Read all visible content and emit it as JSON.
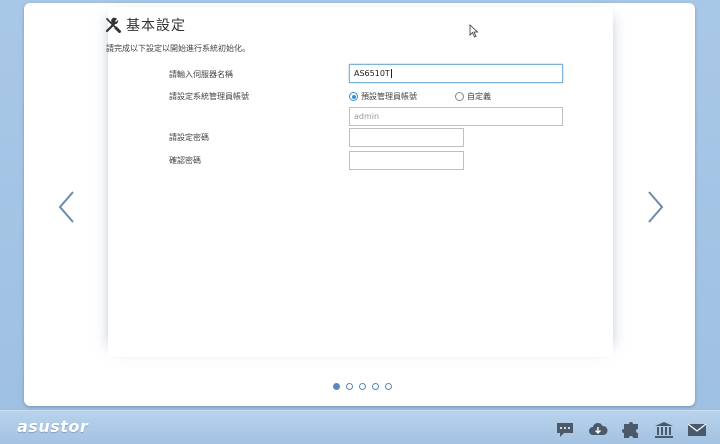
{
  "page": {
    "title": "基本設定",
    "intro": "請完成以下設定以開始進行系統初始化。"
  },
  "form": {
    "server_name_label": "請輸入伺服器名稱",
    "server_name_value": "AS6510T",
    "admin_account_label": "請設定系統管理員帳號",
    "radio_default_label": "預設管理員帳號",
    "radio_custom_label": "自定義",
    "admin_placeholder": "admin",
    "password_label": "請設定密碼",
    "confirm_password_label": "確認密碼"
  },
  "pagination": {
    "total": 5,
    "current": 1
  },
  "footer": {
    "logo": "asustor",
    "icons": [
      "chat-icon",
      "cloud-download-icon",
      "puzzle-icon",
      "bank-icon",
      "mail-icon"
    ]
  },
  "colors": {
    "accent": "#3a8ed8",
    "background": "#a9c8e8",
    "arrow": "#6a8bb0"
  }
}
